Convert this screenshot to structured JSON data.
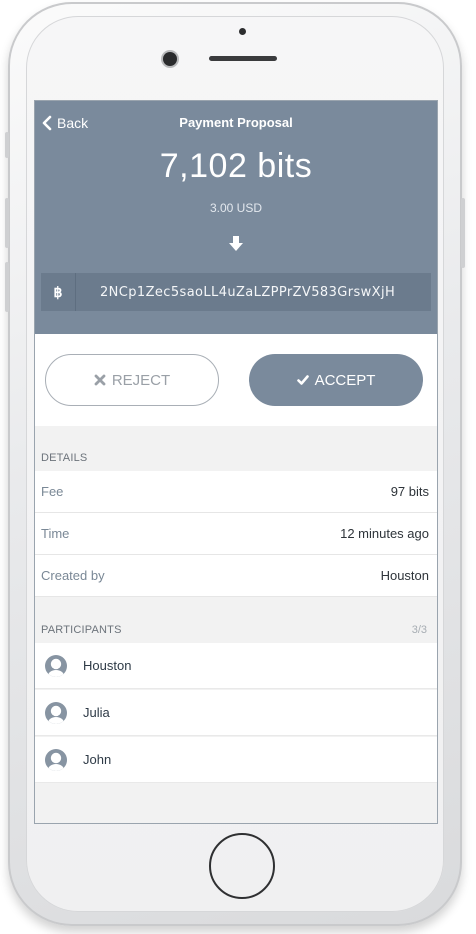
{
  "header": {
    "back_label": "Back",
    "title": "Payment Proposal",
    "amount": "7,102 bits",
    "alternative_amount": "3.00 USD",
    "currency_symbol": "฿",
    "address": "2NCp1Zec5saoLL4uZaLZPPrZV583GrswXjH"
  },
  "actions": {
    "reject_label": "REJECT",
    "accept_label": "ACCEPT"
  },
  "details": {
    "section_label": "DETAILS",
    "rows": [
      {
        "key": "Fee",
        "value": "97 bits"
      },
      {
        "key": "Time",
        "value": "12 minutes ago"
      },
      {
        "key": "Created by",
        "value": "Houston"
      }
    ]
  },
  "participants": {
    "section_label": "PARTICIPANTS",
    "count": "3/3",
    "items": [
      {
        "name": "Houston"
      },
      {
        "name": "Julia"
      },
      {
        "name": "John"
      }
    ]
  },
  "colors": {
    "header_bg": "#7a8a9c",
    "accept_bg": "#7a8a9c",
    "screen_bg": "#f2f2f2"
  },
  "icons": {
    "back": "chevron-left-icon",
    "arrow": "arrow-down-icon",
    "reject": "x-icon",
    "accept": "check-icon",
    "participant": "user-avatar-icon"
  }
}
